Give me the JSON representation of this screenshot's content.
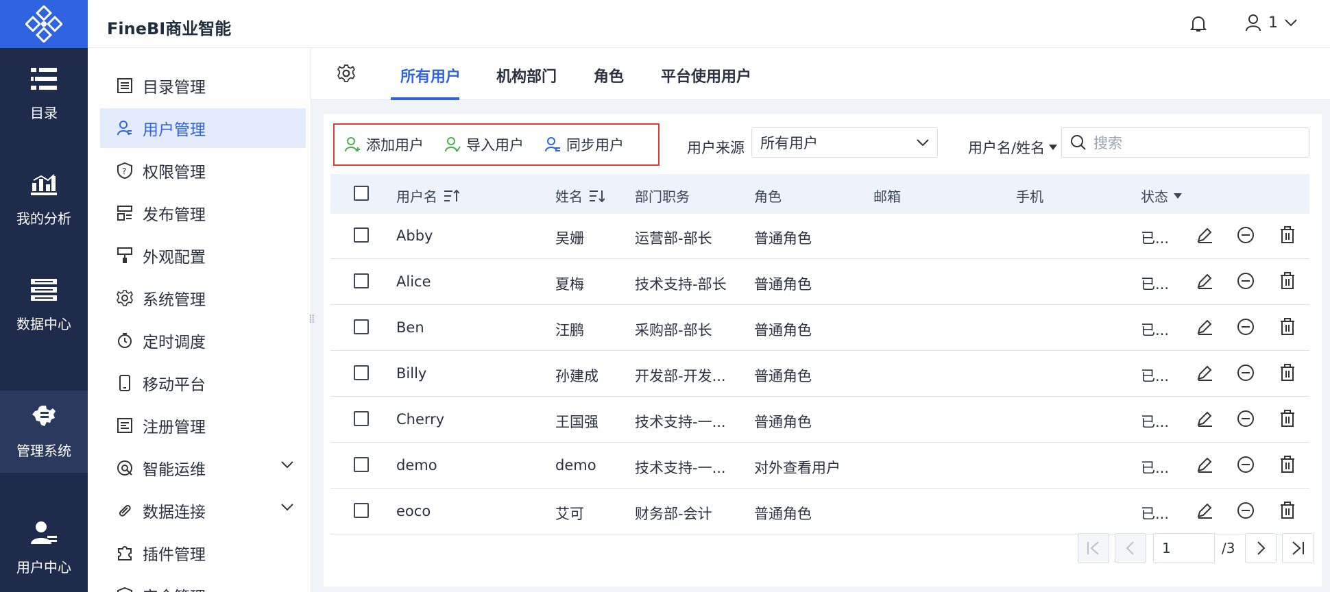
{
  "app": {
    "brand": "FineBI商业智能",
    "user_label": "1"
  },
  "leftnav": [
    {
      "label": "目录",
      "icon": "catalog-icon"
    },
    {
      "label": "我的分析",
      "icon": "analysis-icon"
    },
    {
      "label": "数据中心",
      "icon": "data-center-icon"
    },
    {
      "label": "管理系统",
      "icon": "admin-system-icon"
    },
    {
      "label": "用户中心",
      "icon": "user-center-icon"
    }
  ],
  "submenu": [
    {
      "label": "目录管理",
      "icon": "list-icon"
    },
    {
      "label": "用户管理",
      "icon": "user-icon"
    },
    {
      "label": "权限管理",
      "icon": "shield-icon"
    },
    {
      "label": "发布管理",
      "icon": "publish-icon"
    },
    {
      "label": "外观配置",
      "icon": "brush-icon"
    },
    {
      "label": "系统管理",
      "icon": "gear-icon"
    },
    {
      "label": "定时调度",
      "icon": "timer-icon"
    },
    {
      "label": "移动平台",
      "icon": "mobile-icon"
    },
    {
      "label": "注册管理",
      "icon": "register-icon"
    },
    {
      "label": "智能运维",
      "icon": "ops-icon"
    },
    {
      "label": "数据连接",
      "icon": "link-icon"
    },
    {
      "label": "插件管理",
      "icon": "plugin-icon"
    },
    {
      "label": "安全管理",
      "icon": "security-icon"
    }
  ],
  "tabs": [
    "所有用户",
    "机构部门",
    "角色",
    "平台使用用户"
  ],
  "toolbar": {
    "add_user": "添加用户",
    "import_user": "导入用户",
    "sync_user": "同步用户",
    "source_label": "用户来源",
    "source_value": "所有用户",
    "search_mode": "用户名/姓名",
    "search_placeholder": "搜索"
  },
  "table": {
    "headers": {
      "username": "用户名",
      "realname": "姓名",
      "dept": "部门职务",
      "role": "角色",
      "email": "邮箱",
      "phone": "手机",
      "status": "状态"
    },
    "rows": [
      {
        "username": "Abby",
        "realname": "吴姗",
        "dept": "运营部-部长",
        "role": "普通角色",
        "email": "",
        "phone": "",
        "status": "已..."
      },
      {
        "username": "Alice",
        "realname": "夏梅",
        "dept": "技术支持-部长",
        "role": "普通角色",
        "email": "",
        "phone": "",
        "status": "已..."
      },
      {
        "username": "Ben",
        "realname": "汪鹏",
        "dept": "采购部-部长",
        "role": "普通角色",
        "email": "",
        "phone": "",
        "status": "已..."
      },
      {
        "username": "Billy",
        "realname": "孙建成",
        "dept": "开发部-开发...",
        "role": "普通角色",
        "email": "",
        "phone": "",
        "status": "已..."
      },
      {
        "username": "Cherry",
        "realname": "王国强",
        "dept": "技术支持-一...",
        "role": "普通角色",
        "email": "",
        "phone": "",
        "status": "已..."
      },
      {
        "username": "demo",
        "realname": "demo",
        "dept": "技术支持-一...",
        "role": "对外查看用户",
        "email": "",
        "phone": "",
        "status": "已..."
      },
      {
        "username": "eoco",
        "realname": "艾可",
        "dept": "财务部-会计",
        "role": "普通角色",
        "email": "",
        "phone": "",
        "status": "已..."
      }
    ]
  },
  "pager": {
    "current": "1",
    "total": "/3"
  },
  "colors": {
    "brand_blue": "#2f63e0",
    "nav_dark": "#1e2b4a",
    "highlight_red": "#e53935",
    "add_green": "#4caf50"
  }
}
